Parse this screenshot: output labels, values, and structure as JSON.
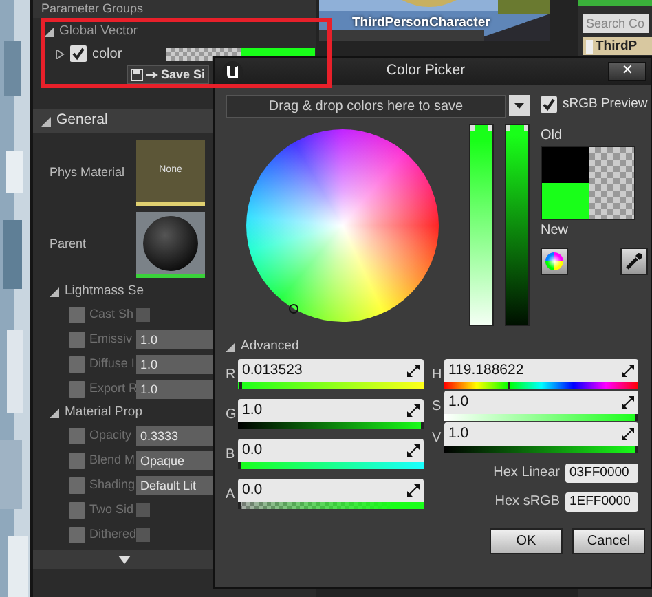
{
  "viewport_thumbnail": {
    "label": "ThirdPersonCharacter"
  },
  "content_browser": {
    "search_placeholder": "Search Co",
    "items": [
      "ThirdP"
    ]
  },
  "details": {
    "header": "Parameter Groups",
    "groups": [
      {
        "title": "Global Vector",
        "expanded": true,
        "params": [
          {
            "name": "color",
            "expanded": false,
            "checked": true
          }
        ]
      }
    ],
    "save_button": "Save Si",
    "sections": [
      {
        "title": "General",
        "kind": "category",
        "expanded": true,
        "rows": [
          {
            "label": "Phys Material",
            "kind": "asset",
            "value": "None"
          },
          {
            "label": "Parent",
            "kind": "sphere"
          }
        ]
      },
      {
        "title": "Lightmass Se",
        "kind": "group",
        "expanded": true,
        "rows": [
          {
            "label": "Cast Sh",
            "kind": "checkbox",
            "override": false,
            "checked": false
          },
          {
            "label": "Emissiv",
            "kind": "text",
            "override": false,
            "value": "1.0"
          },
          {
            "label": "Diffuse I",
            "kind": "text",
            "override": false,
            "value": "1.0"
          },
          {
            "label": "Export R",
            "kind": "text",
            "override": false,
            "value": "1.0"
          }
        ]
      },
      {
        "title": "Material Prop",
        "kind": "group",
        "expanded": true,
        "rows": [
          {
            "label": "Opacity",
            "kind": "text",
            "override": false,
            "value": "0.3333"
          },
          {
            "label": "Blend M",
            "kind": "text",
            "override": false,
            "value": "Opaque"
          },
          {
            "label": "Shading",
            "kind": "text",
            "override": false,
            "value": "Default Lit"
          },
          {
            "label": "Two Sid",
            "kind": "checkbox",
            "override": false,
            "checked": false
          },
          {
            "label": "Dithered",
            "kind": "checkbox",
            "override": false,
            "checked": false
          }
        ]
      }
    ]
  },
  "color_picker": {
    "title": "Color Picker",
    "close": "✕",
    "drop_hint": "Drag & drop colors here to save",
    "srgb_preview": {
      "label": "sRGB Preview",
      "checked": true
    },
    "saturation_bar": {
      "level": 1
    },
    "value_bar": {
      "level": 1
    },
    "old_label": "Old",
    "new_label": "New",
    "advanced": {
      "label": "Advanced",
      "expanded": true
    },
    "rgba_channels": [
      {
        "label": "R",
        "value": "0.013523",
        "kind": "r",
        "level": 0.014
      },
      {
        "label": "G",
        "value": "1.0",
        "kind": "g",
        "level": 1
      },
      {
        "label": "B",
        "value": "0.0",
        "kind": "b",
        "level": 0
      },
      {
        "label": "A",
        "value": "0.0",
        "kind": "a",
        "level": 0
      }
    ],
    "hsv_channels": [
      {
        "label": "H",
        "value": "119.188622",
        "kind": "h",
        "level": 0.331
      },
      {
        "label": "S",
        "value": "1.0",
        "kind": "s",
        "level": 1
      },
      {
        "label": "V",
        "value": "1.0",
        "kind": "v",
        "level": 1
      }
    ],
    "hex_fields": [
      {
        "label": "Hex Linear",
        "value": "03FF0000"
      },
      {
        "label": "Hex sRGB",
        "value": "1EFF0000"
      }
    ],
    "buttons": [
      "OK",
      "Cancel"
    ]
  }
}
